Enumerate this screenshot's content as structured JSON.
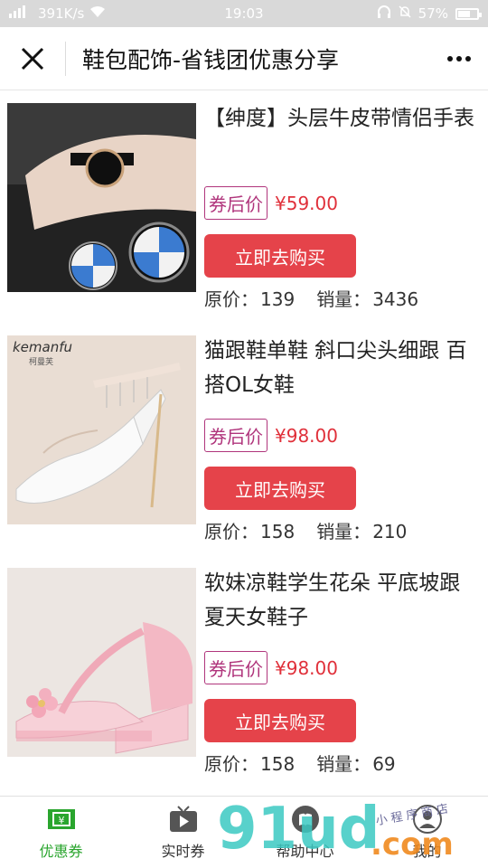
{
  "status_bar": {
    "network_speed": "391K/s",
    "time": "19:03",
    "battery_percent": "57%",
    "battery_level": 0.57
  },
  "header": {
    "title": "鞋包配饰-省钱团优惠分享",
    "close_icon": "close-icon",
    "more_icon": "more-icon"
  },
  "products": [
    {
      "title": "【绅度】头层牛皮带情侣手表",
      "coupon_label": "券后价",
      "price": "¥59.00",
      "buy_label": "立即去购买",
      "original_label": "原价：",
      "original_price": "139",
      "sales_label": "销量：",
      "sales": "3436"
    },
    {
      "title": "猫跟鞋单鞋 斜口尖头细跟 百搭OL女鞋",
      "coupon_label": "券后价",
      "price": "¥98.00",
      "buy_label": "立即去购买",
      "original_label": "原价：",
      "original_price": "158",
      "sales_label": "销量：",
      "sales": "210",
      "image_brand": "kemanfu",
      "image_brand_cn": "柯曼芙"
    },
    {
      "title": "软妹凉鞋学生花朵 平底坡跟 夏天女鞋子",
      "coupon_label": "券后价",
      "price": "¥98.00",
      "buy_label": "立即去购买",
      "original_label": "原价：",
      "original_price": "158",
      "sales_label": "销量：",
      "sales": "69"
    }
  ],
  "tabbar": {
    "tabs": [
      {
        "label": "优惠券",
        "icon": "coupon-ticket-icon",
        "active": true
      },
      {
        "label": "实时券",
        "icon": "tv-play-icon",
        "active": false
      },
      {
        "label": "帮助中心",
        "icon": "help-book-icon",
        "active": false
      },
      {
        "label": "我的",
        "icon": "user-icon",
        "active": false
      }
    ]
  },
  "watermark": {
    "logo_text": "91ud",
    "domain_text": ".com",
    "handwritten_text": "小程序商店"
  },
  "colors": {
    "accent_green": "#2aa52e",
    "buy_button": "#e5434a",
    "price_red": "#e0303a",
    "coupon_border": "#b0357c"
  }
}
